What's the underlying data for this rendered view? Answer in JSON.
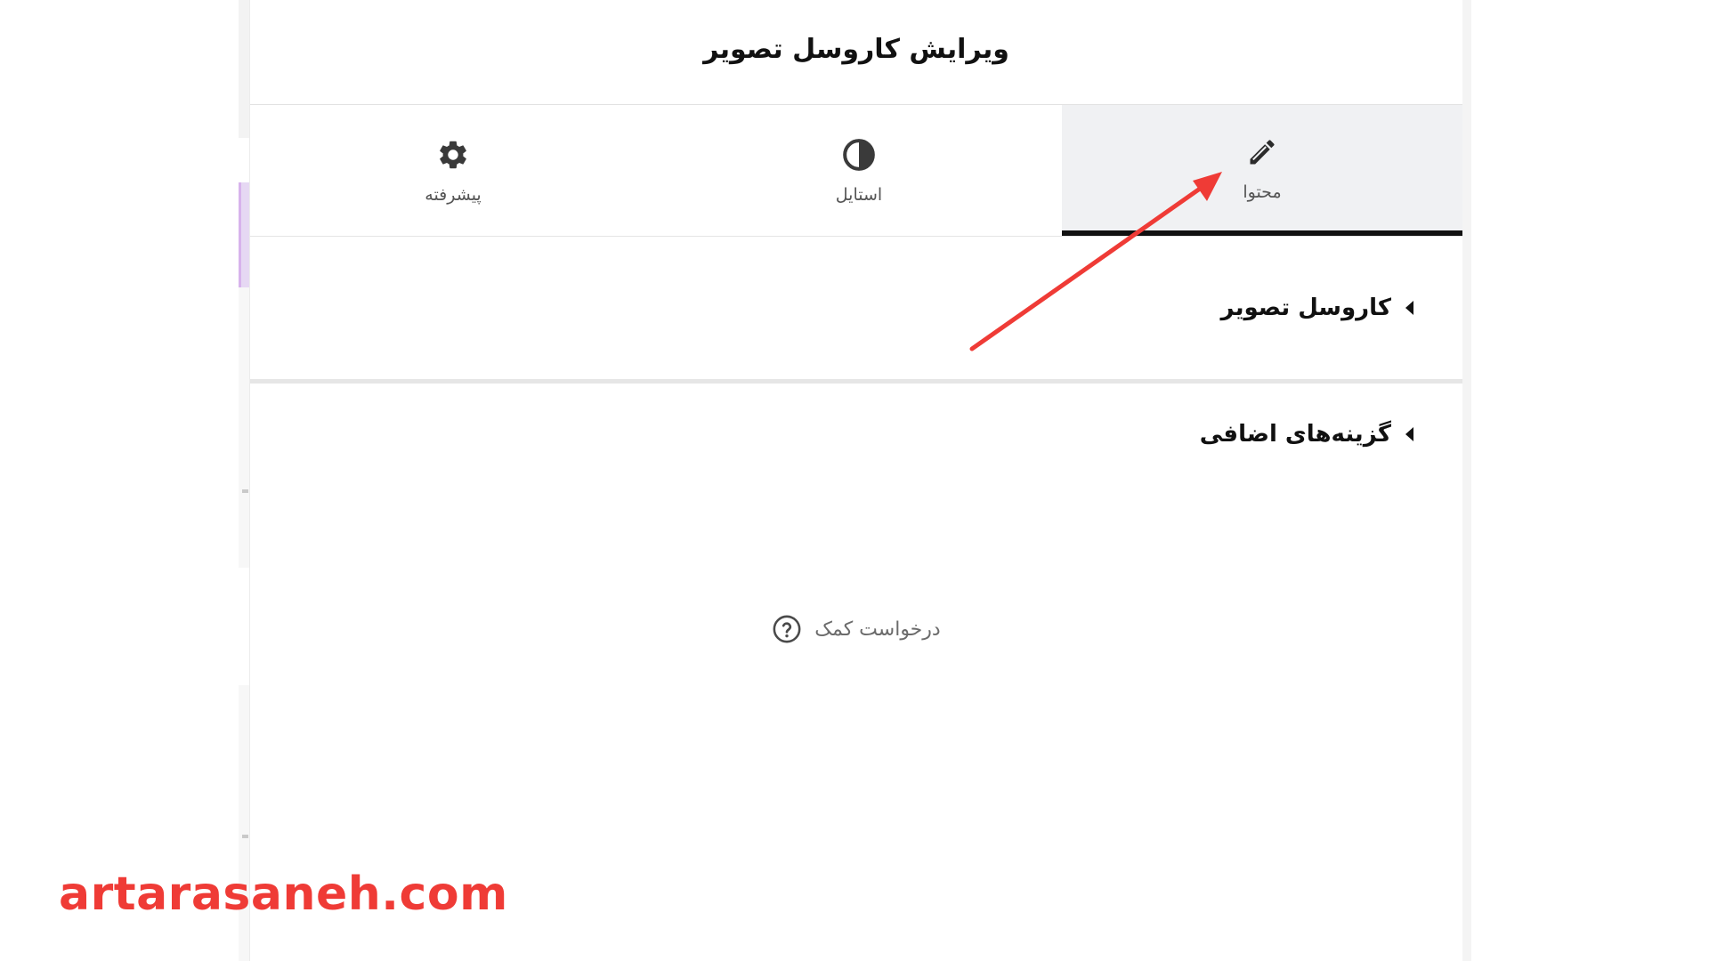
{
  "panel": {
    "title": "ویرایش کاروسل تصویر"
  },
  "tabs": [
    {
      "label": "محتوا",
      "icon": "pencil-icon",
      "active": true
    },
    {
      "label": "استایل",
      "icon": "contrast-icon",
      "active": false
    },
    {
      "label": "پیشرفته",
      "icon": "gear-icon",
      "active": false
    }
  ],
  "sections": [
    {
      "label": "کاروسل تصویر"
    },
    {
      "label": "گزینه‌های اضافی"
    }
  ],
  "help": {
    "label": "درخواست کمک",
    "icon": "question-circle-icon"
  },
  "annotation": {
    "arrow_color": "#ef3b36"
  },
  "watermark": {
    "text": "artarasaneh.com",
    "color": "#ef3b36"
  }
}
